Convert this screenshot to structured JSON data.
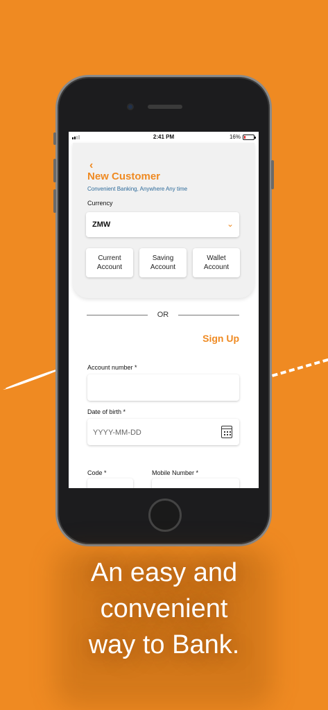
{
  "status_bar": {
    "time": "2:41 PM",
    "battery": "16%",
    "battery_level": 0.16
  },
  "header": {
    "back_icon": "chevron-left-icon",
    "title": "New Customer",
    "subtitle": "Convenient Banking, Anywhere Any time"
  },
  "currency": {
    "label": "Currency",
    "value": "ZMW",
    "icon": "chevron-down-icon"
  },
  "account_types": [
    {
      "line1": "Current",
      "line2": "Account"
    },
    {
      "line1": "Saving",
      "line2": "Account"
    },
    {
      "line1": "Wallet",
      "line2": "Account"
    }
  ],
  "divider": {
    "text": "OR"
  },
  "signup": {
    "title": "Sign Up",
    "account_number": {
      "label": "Account number *",
      "value": ""
    },
    "dob": {
      "label": "Date of birth *",
      "placeholder": "YYYY-MM-DD",
      "icon": "calendar-icon"
    },
    "code": {
      "label": "Code *"
    },
    "mobile": {
      "label": "Mobile Number *"
    }
  },
  "tagline": {
    "line1": "An easy and",
    "line2": "convenient",
    "line3": "way to Bank."
  },
  "colors": {
    "accent": "#ef8a22",
    "subtitle": "#2d6a9a",
    "background": "#ef8a22"
  }
}
